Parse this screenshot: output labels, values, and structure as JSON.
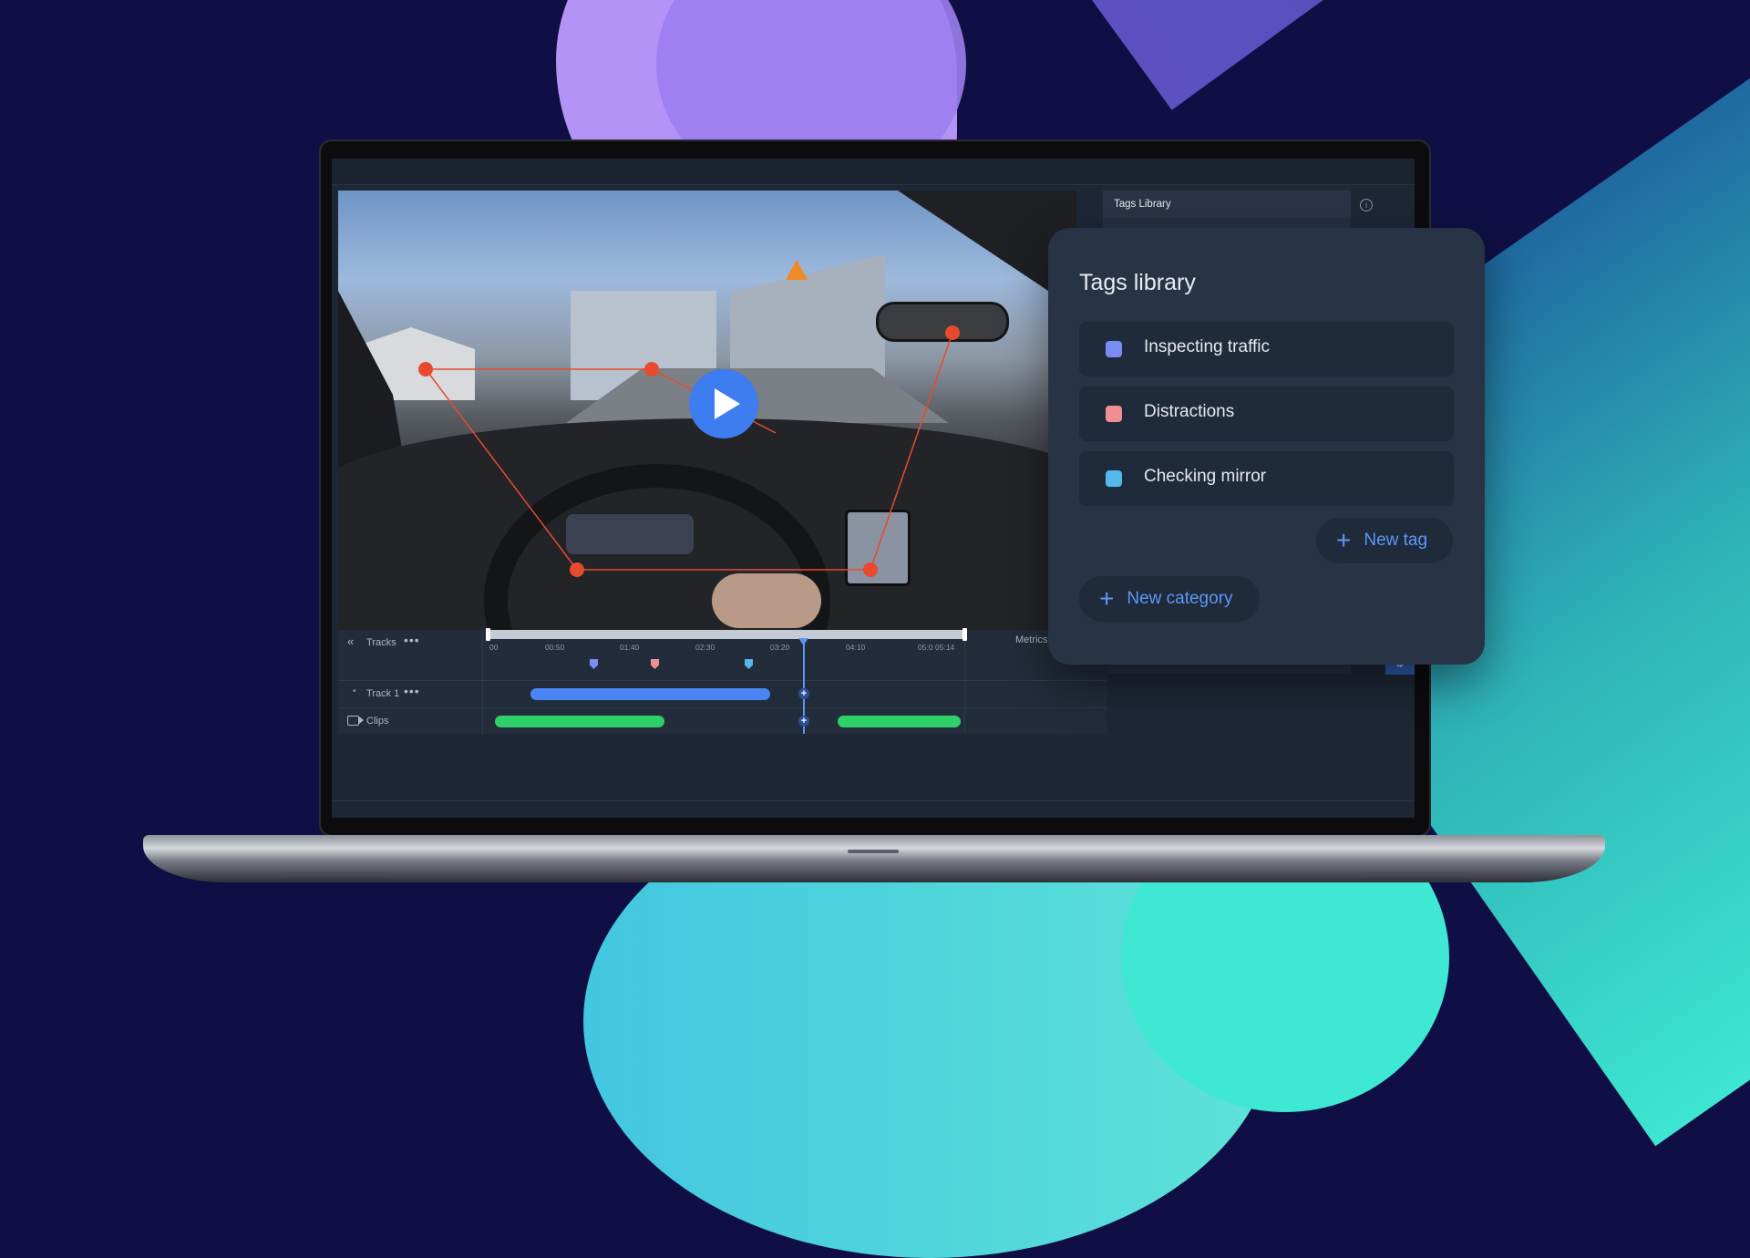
{
  "tags_tab": {
    "label": "Tags Library"
  },
  "side_label": "Ne",
  "timeline": {
    "tracks_label": "Tracks",
    "track1_label": "Track 1",
    "clips_label": "Clips",
    "metrics_label": "Metrics",
    "more_glyph": "•••",
    "ticks": [
      "00",
      "00:50",
      "01:40",
      "02:30",
      "03:20",
      "04:10",
      "05:0",
      "05:14"
    ]
  },
  "tags_library": {
    "title": "Tags library",
    "tags": [
      {
        "label": "Inspecting traffic",
        "color": "#7b8cf3"
      },
      {
        "label": "Distractions",
        "color": "#f08f93"
      },
      {
        "label": "Checking mirror",
        "color": "#55b7ea"
      }
    ],
    "new_tag_label": "New tag",
    "new_category_label": "New category"
  },
  "colors": {
    "accent": "#3d7df0",
    "track_bar": "#4a86f3",
    "clip_bar": "#2fcf6a",
    "annotation": "#e84a2e"
  }
}
